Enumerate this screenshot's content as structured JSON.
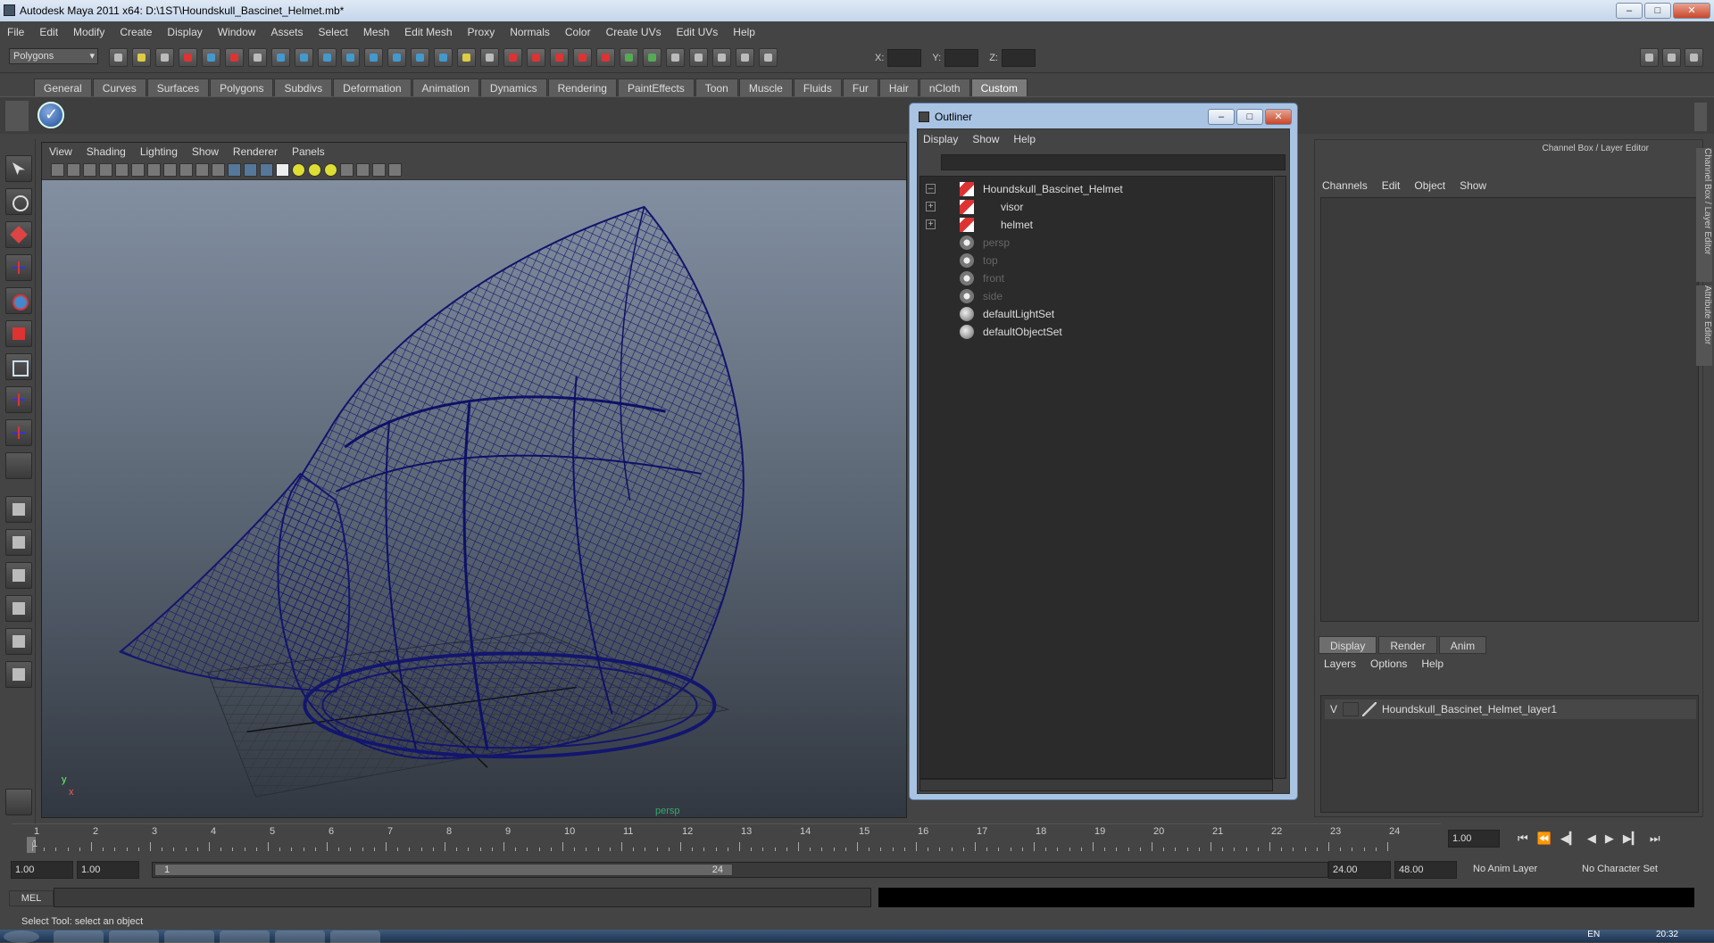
{
  "window": {
    "title": "Autodesk Maya 2011 x64: D:\\1ST\\Houndskull_Bascinet_Helmet.mb*",
    "btn_min": "–",
    "btn_max": "□",
    "btn_close": "✕"
  },
  "menubar": [
    "File",
    "Edit",
    "Modify",
    "Create",
    "Display",
    "Window",
    "Assets",
    "Select",
    "Mesh",
    "Edit Mesh",
    "Proxy",
    "Normals",
    "Color",
    "Create UVs",
    "Edit UVs",
    "Help"
  ],
  "statusline": {
    "mode": "Polygons",
    "x_label": "X:",
    "y_label": "Y:",
    "z_label": "Z:"
  },
  "shelf_tabs": [
    "General",
    "Curves",
    "Surfaces",
    "Polygons",
    "Subdivs",
    "Deformation",
    "Animation",
    "Dynamics",
    "Rendering",
    "PaintEffects",
    "Toon",
    "Muscle",
    "Fluids",
    "Fur",
    "Hair",
    "nCloth",
    "Custom"
  ],
  "shelf_active": "Custom",
  "viewport": {
    "menu": [
      "View",
      "Shading",
      "Lighting",
      "Show",
      "Renderer",
      "Panels"
    ],
    "camera": "persp",
    "axis_y": "y",
    "axis_x": "x",
    "wire_color": "#13166e"
  },
  "outliner": {
    "title": "Outliner",
    "menu": [
      "Display",
      "Show",
      "Help"
    ],
    "items": [
      {
        "label": "Houndskull_Bascinet_Helmet",
        "expander": "–",
        "icon": "mesh-icon"
      },
      {
        "label": "visor",
        "expander": "+",
        "icon": "mesh-icon"
      },
      {
        "label": "helmet",
        "expander": "+",
        "icon": "mesh-icon"
      },
      {
        "label": "persp",
        "icon": "camera-icon"
      },
      {
        "label": "top",
        "icon": "camera-icon"
      },
      {
        "label": "front",
        "icon": "camera-icon"
      },
      {
        "label": "side",
        "icon": "camera-icon"
      },
      {
        "label": "defaultLightSet",
        "icon": "set-icon"
      },
      {
        "label": "defaultObjectSet",
        "icon": "set-icon"
      }
    ]
  },
  "channel_box": {
    "title": "Channel Box / Layer Editor",
    "menu": [
      "Channels",
      "Edit",
      "Object",
      "Show"
    ],
    "tabs": [
      "Display",
      "Render",
      "Anim"
    ],
    "layer_menu": [
      "Layers",
      "Options",
      "Help"
    ],
    "layer_visibility": "V",
    "layer_name": "Houndskull_Bascinet_Helmet_layer1",
    "side_tabs": [
      "Channel Box / Layer Editor",
      "Attribute Editor"
    ]
  },
  "timeline": {
    "ticks": [
      "1",
      "2",
      "3",
      "4",
      "5",
      "6",
      "7",
      "8",
      "9",
      "10",
      "11",
      "12",
      "13",
      "14",
      "15",
      "16",
      "17",
      "18",
      "19",
      "20",
      "21",
      "22",
      "23",
      "24"
    ],
    "current_frame": "1",
    "current_time": "1.00",
    "play_buttons": [
      "⏮",
      "⏪",
      "◀▎",
      "◀",
      "▶",
      "▶▎",
      "⏭"
    ]
  },
  "range": {
    "start": "1.00",
    "start2": "1.00",
    "slider_start": "1",
    "slider_end": "24",
    "end": "24.00",
    "end2": "48.00",
    "anim_layer": "No Anim Layer",
    "char_set": "No Character Set"
  },
  "cmdline": {
    "label": "MEL"
  },
  "help_line": "Select Tool: select an object",
  "tray": {
    "lang": "EN",
    "time": "20:32"
  }
}
